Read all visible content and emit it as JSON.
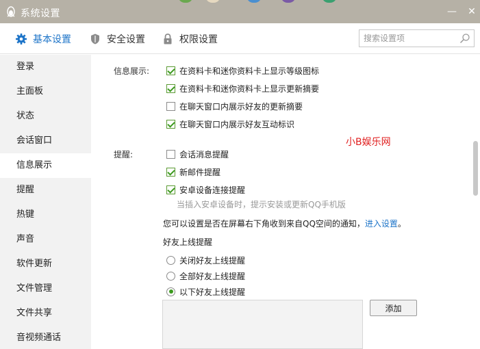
{
  "window": {
    "title": "系统设置",
    "minimize_glyph": "—",
    "close_glyph": "✕"
  },
  "tabs": [
    {
      "label": "基本设置",
      "icon": "gear-icon",
      "active": true
    },
    {
      "label": "安全设置",
      "icon": "shield-icon",
      "active": false
    },
    {
      "label": "权限设置",
      "icon": "lock-icon",
      "active": false
    }
  ],
  "search": {
    "placeholder": "搜索设置项",
    "value": ""
  },
  "sidebar": {
    "items": [
      {
        "label": "登录"
      },
      {
        "label": "主面板"
      },
      {
        "label": "状态"
      },
      {
        "label": "会话窗口"
      },
      {
        "label": "信息展示",
        "active": true
      },
      {
        "label": "提醒"
      },
      {
        "label": "热键"
      },
      {
        "label": "声音"
      },
      {
        "label": "软件更新"
      },
      {
        "label": "文件管理"
      },
      {
        "label": "文件共享"
      },
      {
        "label": "音视频通话"
      }
    ]
  },
  "info_display": {
    "label": "信息展示:",
    "options": [
      {
        "label": "在资料卡和迷你资料卡上显示等级图标",
        "checked": true
      },
      {
        "label": "在资料卡和迷你资料卡上显示更新摘要",
        "checked": true
      },
      {
        "label": "在聊天窗口内展示好友的更新摘要",
        "checked": false
      },
      {
        "label": "在聊天窗口内展示好友互动标识",
        "checked": true
      }
    ]
  },
  "watermark": "小B娱乐网",
  "reminders": {
    "label": "提醒:",
    "options": [
      {
        "label": "会话消息提醒",
        "checked": false
      },
      {
        "label": "新邮件提醒",
        "checked": true
      },
      {
        "label": "安卓设备连接提醒",
        "checked": true
      }
    ],
    "android_hint": "当插入安卓设备时，提示安装或更新QQ手机版",
    "qzone_note": "您可以设置是否在屏幕右下角收到来自QQ空间的通知，",
    "qzone_link": "进入设置",
    "qzone_end": "。"
  },
  "friend_online": {
    "title": "好友上线提醒",
    "options": [
      {
        "label": "关闭好友上线提醒",
        "selected": false
      },
      {
        "label": "全部好友上线提醒",
        "selected": false
      },
      {
        "label": "以下好友上线提醒",
        "selected": true
      }
    ],
    "add_button": "添加"
  },
  "colors": {
    "titlebar": "#b6b1a6",
    "accent": "#1d74c8",
    "check": "#3c9a1e",
    "watermark": "#e02020"
  }
}
